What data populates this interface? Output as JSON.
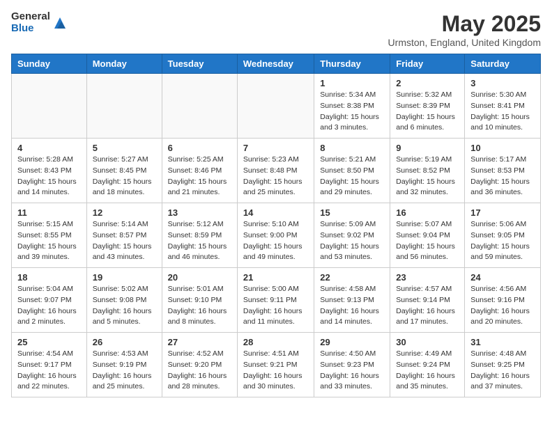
{
  "logo": {
    "general": "General",
    "blue": "Blue"
  },
  "header": {
    "month_year": "May 2025",
    "location": "Urmston, England, United Kingdom"
  },
  "weekdays": [
    "Sunday",
    "Monday",
    "Tuesday",
    "Wednesday",
    "Thursday",
    "Friday",
    "Saturday"
  ],
  "weeks": [
    [
      {
        "day": "",
        "info": ""
      },
      {
        "day": "",
        "info": ""
      },
      {
        "day": "",
        "info": ""
      },
      {
        "day": "",
        "info": ""
      },
      {
        "day": "1",
        "info": "Sunrise: 5:34 AM\nSunset: 8:38 PM\nDaylight: 15 hours\nand 3 minutes."
      },
      {
        "day": "2",
        "info": "Sunrise: 5:32 AM\nSunset: 8:39 PM\nDaylight: 15 hours\nand 6 minutes."
      },
      {
        "day": "3",
        "info": "Sunrise: 5:30 AM\nSunset: 8:41 PM\nDaylight: 15 hours\nand 10 minutes."
      }
    ],
    [
      {
        "day": "4",
        "info": "Sunrise: 5:28 AM\nSunset: 8:43 PM\nDaylight: 15 hours\nand 14 minutes."
      },
      {
        "day": "5",
        "info": "Sunrise: 5:27 AM\nSunset: 8:45 PM\nDaylight: 15 hours\nand 18 minutes."
      },
      {
        "day": "6",
        "info": "Sunrise: 5:25 AM\nSunset: 8:46 PM\nDaylight: 15 hours\nand 21 minutes."
      },
      {
        "day": "7",
        "info": "Sunrise: 5:23 AM\nSunset: 8:48 PM\nDaylight: 15 hours\nand 25 minutes."
      },
      {
        "day": "8",
        "info": "Sunrise: 5:21 AM\nSunset: 8:50 PM\nDaylight: 15 hours\nand 29 minutes."
      },
      {
        "day": "9",
        "info": "Sunrise: 5:19 AM\nSunset: 8:52 PM\nDaylight: 15 hours\nand 32 minutes."
      },
      {
        "day": "10",
        "info": "Sunrise: 5:17 AM\nSunset: 8:53 PM\nDaylight: 15 hours\nand 36 minutes."
      }
    ],
    [
      {
        "day": "11",
        "info": "Sunrise: 5:15 AM\nSunset: 8:55 PM\nDaylight: 15 hours\nand 39 minutes."
      },
      {
        "day": "12",
        "info": "Sunrise: 5:14 AM\nSunset: 8:57 PM\nDaylight: 15 hours\nand 43 minutes."
      },
      {
        "day": "13",
        "info": "Sunrise: 5:12 AM\nSunset: 8:59 PM\nDaylight: 15 hours\nand 46 minutes."
      },
      {
        "day": "14",
        "info": "Sunrise: 5:10 AM\nSunset: 9:00 PM\nDaylight: 15 hours\nand 49 minutes."
      },
      {
        "day": "15",
        "info": "Sunrise: 5:09 AM\nSunset: 9:02 PM\nDaylight: 15 hours\nand 53 minutes."
      },
      {
        "day": "16",
        "info": "Sunrise: 5:07 AM\nSunset: 9:04 PM\nDaylight: 15 hours\nand 56 minutes."
      },
      {
        "day": "17",
        "info": "Sunrise: 5:06 AM\nSunset: 9:05 PM\nDaylight: 15 hours\nand 59 minutes."
      }
    ],
    [
      {
        "day": "18",
        "info": "Sunrise: 5:04 AM\nSunset: 9:07 PM\nDaylight: 16 hours\nand 2 minutes."
      },
      {
        "day": "19",
        "info": "Sunrise: 5:02 AM\nSunset: 9:08 PM\nDaylight: 16 hours\nand 5 minutes."
      },
      {
        "day": "20",
        "info": "Sunrise: 5:01 AM\nSunset: 9:10 PM\nDaylight: 16 hours\nand 8 minutes."
      },
      {
        "day": "21",
        "info": "Sunrise: 5:00 AM\nSunset: 9:11 PM\nDaylight: 16 hours\nand 11 minutes."
      },
      {
        "day": "22",
        "info": "Sunrise: 4:58 AM\nSunset: 9:13 PM\nDaylight: 16 hours\nand 14 minutes."
      },
      {
        "day": "23",
        "info": "Sunrise: 4:57 AM\nSunset: 9:14 PM\nDaylight: 16 hours\nand 17 minutes."
      },
      {
        "day": "24",
        "info": "Sunrise: 4:56 AM\nSunset: 9:16 PM\nDaylight: 16 hours\nand 20 minutes."
      }
    ],
    [
      {
        "day": "25",
        "info": "Sunrise: 4:54 AM\nSunset: 9:17 PM\nDaylight: 16 hours\nand 22 minutes."
      },
      {
        "day": "26",
        "info": "Sunrise: 4:53 AM\nSunset: 9:19 PM\nDaylight: 16 hours\nand 25 minutes."
      },
      {
        "day": "27",
        "info": "Sunrise: 4:52 AM\nSunset: 9:20 PM\nDaylight: 16 hours\nand 28 minutes."
      },
      {
        "day": "28",
        "info": "Sunrise: 4:51 AM\nSunset: 9:21 PM\nDaylight: 16 hours\nand 30 minutes."
      },
      {
        "day": "29",
        "info": "Sunrise: 4:50 AM\nSunset: 9:23 PM\nDaylight: 16 hours\nand 33 minutes."
      },
      {
        "day": "30",
        "info": "Sunrise: 4:49 AM\nSunset: 9:24 PM\nDaylight: 16 hours\nand 35 minutes."
      },
      {
        "day": "31",
        "info": "Sunrise: 4:48 AM\nSunset: 9:25 PM\nDaylight: 16 hours\nand 37 minutes."
      }
    ]
  ]
}
